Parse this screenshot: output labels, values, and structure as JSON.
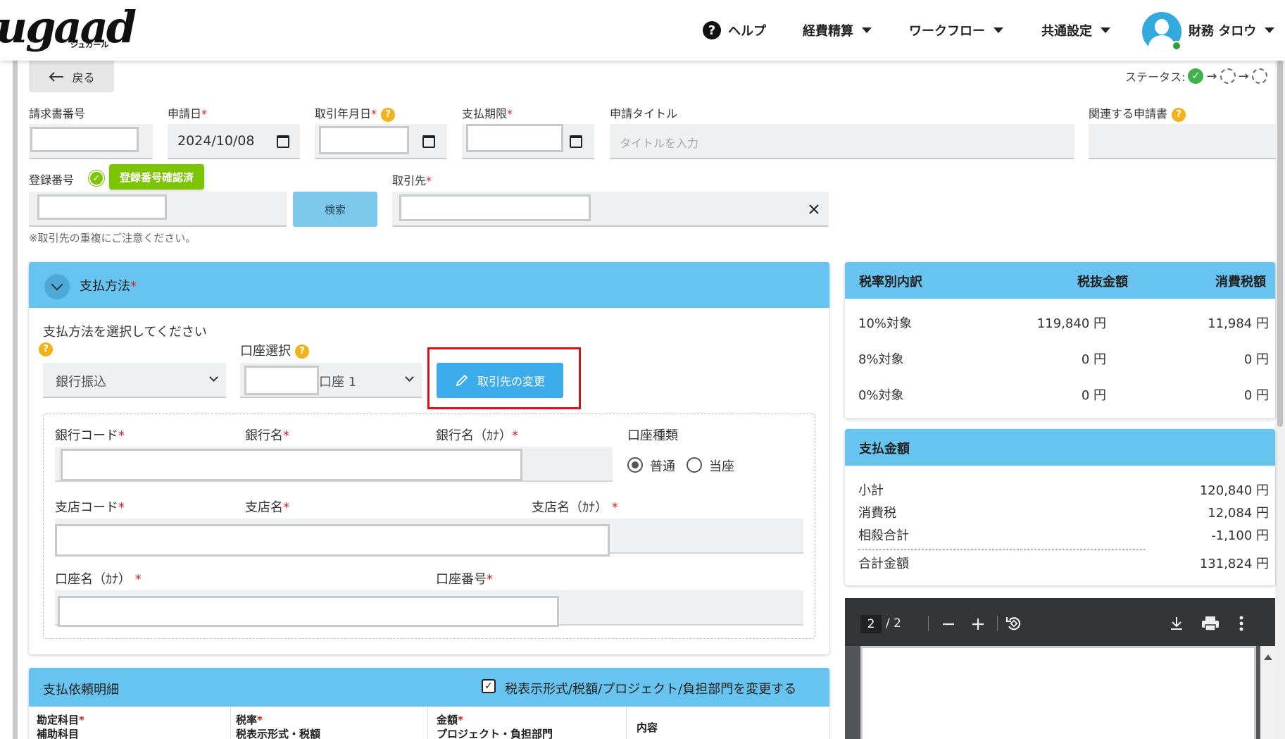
{
  "header": {
    "logo_text": "ugaad",
    "logo_sub": "ジュガール",
    "help_label": "ヘルプ",
    "nav_items": [
      {
        "label": "経費精算"
      },
      {
        "label": "ワークフロー"
      },
      {
        "label": "共通設定"
      }
    ],
    "user_name": "財務 タロウ"
  },
  "top": {
    "back_label": "戻る",
    "status_label": "ステータス:"
  },
  "form": {
    "invoice_no_label": "請求書番号",
    "apply_date_label": "申請日",
    "apply_date_value": "2024/10/08",
    "trade_date_label": "取引年月日",
    "due_date_label": "支払期限",
    "title_label": "申請タイトル",
    "title_placeholder": "タイトルを入力",
    "related_label": "関連する申請書",
    "reg_no_label": "登録番号",
    "reg_badge": "登録番号確認済",
    "search_label": "検索",
    "partner_label": "取引先",
    "note": "※取引先の重複にご注意ください。",
    "required_mark": "*"
  },
  "payment": {
    "title": "支払方法",
    "method_prompt": "支払方法を選択してください",
    "method_value": "銀行振込",
    "account_label": "口座選択",
    "account_value": "口座 1",
    "change_btn": "取引先の変更",
    "bank_code": "銀行コード",
    "bank_name": "銀行名",
    "bank_kana": "銀行名（ｶﾅ）",
    "account_type": "口座種類",
    "type_normal": "普通",
    "type_current": "当座",
    "branch_code": "支店コード",
    "branch_name": "支店名",
    "branch_kana": "支店名（ｶﾅ）",
    "holder_kana": "口座名（ｶﾅ）",
    "account_no": "口座番号"
  },
  "tax_table": {
    "headers": [
      "税率別内訳",
      "税抜金額",
      "消費税額"
    ],
    "rows": [
      {
        "rate": "10%対象",
        "net": "119,840 円",
        "tax": "11,984 円"
      },
      {
        "rate": "8%対象",
        "net": "0 円",
        "tax": "0 円"
      },
      {
        "rate": "0%対象",
        "net": "0 円",
        "tax": "0 円"
      }
    ]
  },
  "payment_amount": {
    "title": "支払金額",
    "rows": [
      {
        "label": "小計",
        "value": "120,840 円"
      },
      {
        "label": "消費税",
        "value": "12,084 円"
      },
      {
        "label": "相殺合計",
        "value": "-1,100 円"
      },
      {
        "label": "合計金額",
        "value": "131,824 円"
      }
    ]
  },
  "pdf": {
    "page": "2",
    "total": "/ 2"
  },
  "details": {
    "title": "支払依頼明細",
    "toggle_label": "税表示形式/税額/プロジェクト/負担部門を変更する",
    "col1_a": "勘定科目",
    "col1_b": "補助科目",
    "col2_a": "税率",
    "col2_b": "税表示形式・税額",
    "col3_a": "金額",
    "col3_b": "プロジェクト・負担部門",
    "col4": "内容"
  },
  "colors": {
    "accent": "#67c3ef",
    "button": "#3dacea",
    "badge": "#7cc400",
    "highlight": "#d8121b"
  }
}
